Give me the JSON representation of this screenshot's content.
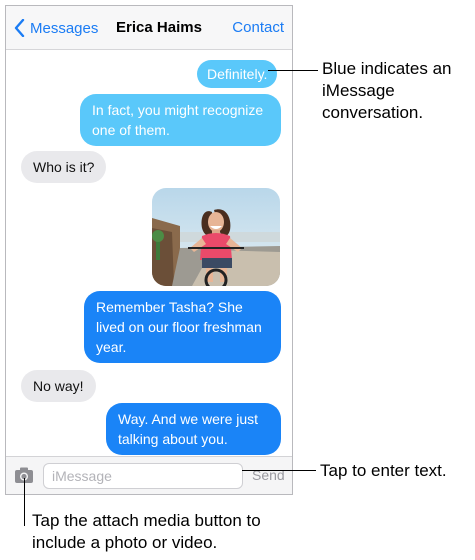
{
  "navbar": {
    "back_label": "Messages",
    "title": "Erica Haims",
    "contact_label": "Contact"
  },
  "messages": [
    {
      "sender": "me",
      "type": "imessage",
      "text": "Definitely."
    },
    {
      "sender": "me",
      "type": "imessage",
      "text": "In fact, you might recognize one of them."
    },
    {
      "sender": "them",
      "type": "text",
      "text": "Who is it?"
    },
    {
      "sender": "me",
      "type": "photo",
      "text": ""
    },
    {
      "sender": "me",
      "type": "imessage",
      "text": "Remember Tasha? She lived on our floor freshman year."
    },
    {
      "sender": "them",
      "type": "text",
      "text": "No way!"
    },
    {
      "sender": "me",
      "type": "imessage",
      "text": "Way. And we were just talking about you."
    }
  ],
  "toolbar": {
    "input_placeholder": "iMessage",
    "send_label": "Send"
  },
  "callouts": {
    "blue_bubble": "Blue indicates an iMessage conversation.",
    "input": "Tap to enter text.",
    "camera": "Tap the attach media button to include a photo or video."
  },
  "colors": {
    "accent": "#1b7cf4",
    "imessage_bubble": "#1a84f7",
    "imessage_bubble_light": "#5ac8fa",
    "received_bubble": "#e9e9ec"
  }
}
